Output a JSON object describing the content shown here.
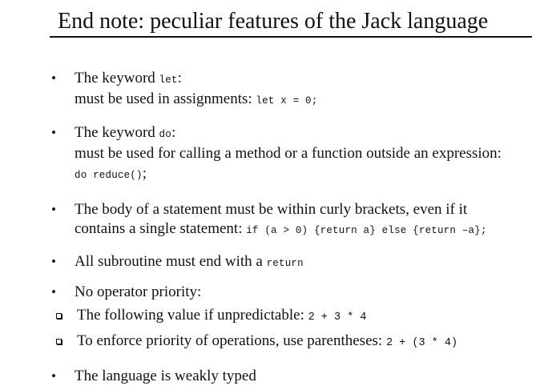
{
  "title": "End note: peculiar features of the Jack language",
  "bullet_glyph": "•",
  "sub_bullet_glyph": "square-outline-icon",
  "bullets": [
    {
      "line1_text": "The keyword ",
      "line1_code": "let",
      "line1_tail": ":",
      "line2_text": "must be used in assignments: ",
      "line2_code": "let x = 0;"
    },
    {
      "line1_text": "The keyword ",
      "line1_code": "do",
      "line1_tail": ":",
      "line2_text": "must be used for calling a method or a function outside an expression:",
      "line3_code": "do reduce()",
      "line3_tail": ";"
    },
    {
      "line1_text": "The body of a statement must be within curly brackets, even if it",
      "line2_text": "contains a single statement: ",
      "line2_code": "if (a > 0) {return a} else {return –a};"
    },
    {
      "line1_text": "All subroutine must end with a ",
      "line1_code": "return"
    },
    {
      "line1_text": "No operator priority:",
      "subs": [
        {
          "text": "The following value if unpredictable: ",
          "code": "2 + 3 * 4"
        },
        {
          "text": "To enforce priority of operations, use parentheses: ",
          "code": "2 + (3 * 4)"
        }
      ]
    },
    {
      "line1_text": "The language is weakly typed"
    }
  ]
}
